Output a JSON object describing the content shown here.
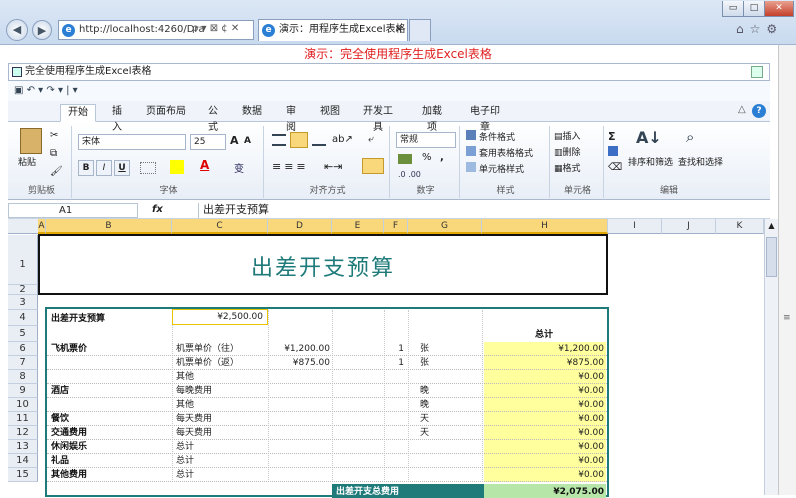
{
  "browser": {
    "address": "http://localhost:4260/Dra",
    "addr_controls": "ρ ▾ ⊠ ¢ ✕",
    "tab_active": "演示：用程序生成Excel表格",
    "tab_close": "×",
    "win_buttons": [
      "▭",
      "□",
      "✕"
    ],
    "back_glyph": "◀",
    "fwd_glyph": "▶",
    "toolbar_glyphs": [
      "⌂",
      "☆",
      "⚙"
    ]
  },
  "page_caption": "演示：完全使用程序生成Excel表格",
  "excel": {
    "title": "完全使用程序生成Excel表格",
    "qat": "▣ ↶ ▾ ↷ ▾ | ▾",
    "tabs": [
      "开始",
      "插入",
      "页面布局",
      "公式",
      "数据",
      "审阅",
      "视图",
      "开发工具",
      "加载项",
      "电子印章"
    ],
    "active_tab": "开始",
    "ribbon": {
      "clipboard": {
        "paste": "粘贴",
        "label": "剪贴板"
      },
      "font": {
        "name": "宋体",
        "size": "25",
        "label": "字体",
        "bold": "B",
        "italic": "I",
        "underline": "U",
        "grow": "A",
        "shrink": "A",
        "color": "A",
        "wen": "变"
      },
      "align": {
        "label": "对齐方式"
      },
      "number": {
        "format": "常规",
        "pct": "%",
        "comma": ",",
        "label": "数字"
      },
      "styles": {
        "items": [
          "条件格式",
          "套用表格格式",
          "单元格样式"
        ],
        "label": "样式"
      },
      "cells": {
        "items": [
          "插入",
          "删除",
          "格式"
        ],
        "label": "单元格"
      },
      "edit": {
        "sigma": "Σ",
        "sort": "排序和筛选",
        "find": "查找和选择",
        "label": "编辑"
      }
    },
    "formula": {
      "namebox": "A1",
      "fx": "fx",
      "value": "出差开支预算"
    },
    "columns": [
      "A",
      "B",
      "C",
      "D",
      "E",
      "F",
      "G",
      "H",
      "I",
      "J",
      "K"
    ],
    "rows": [
      "1",
      "2",
      "3",
      "4",
      "5",
      "6",
      "7",
      "8",
      "9",
      "10",
      "11",
      "12",
      "13",
      "14",
      "15"
    ],
    "sheet": {
      "title": "出差开支预算",
      "budget_label": "出差开支预算",
      "budget_value": "¥2,500.00",
      "total_header": "总计",
      "items": [
        {
          "b": "飞机票价",
          "c": "机票单价（往）",
          "d": "¥1,200.00",
          "f": "1",
          "g": "张",
          "h": "¥1,200.00"
        },
        {
          "b": "",
          "c": "机票单价（返）",
          "d": "¥875.00",
          "f": "1",
          "g": "张",
          "h": "¥875.00"
        },
        {
          "b": "",
          "c": "其他",
          "d": "",
          "f": "",
          "g": "",
          "h": "¥0.00"
        },
        {
          "b": "酒店",
          "c": "每晚费用",
          "d": "",
          "f": "",
          "g": "晚",
          "h": "¥0.00"
        },
        {
          "b": "",
          "c": "其他",
          "d": "",
          "f": "",
          "g": "晚",
          "h": "¥0.00"
        },
        {
          "b": "餐饮",
          "c": "每天费用",
          "d": "",
          "f": "",
          "g": "天",
          "h": "¥0.00"
        },
        {
          "b": "交通费用",
          "c": "每天费用",
          "d": "",
          "f": "",
          "g": "天",
          "h": "¥0.00"
        },
        {
          "b": "休闲娱乐",
          "c": "总计",
          "d": "",
          "f": "",
          "g": "",
          "h": "¥0.00"
        },
        {
          "b": "礼品",
          "c": "总计",
          "d": "",
          "f": "",
          "g": "",
          "h": "¥0.00"
        },
        {
          "b": "其他费用",
          "c": "总计",
          "d": "",
          "f": "",
          "g": "",
          "h": "¥0.00"
        }
      ],
      "footer_label": "出差开支总费用",
      "footer_value": "¥2,075.00"
    }
  },
  "colors": {
    "teal": "#1f7a7a",
    "yellow": "#ffff9e",
    "selected": "#f9d77b",
    "caption": "#e02020"
  }
}
